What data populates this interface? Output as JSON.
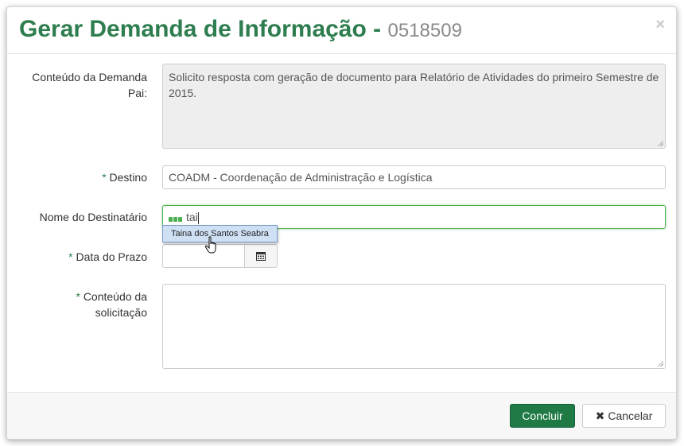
{
  "modal": {
    "title": "Gerar Demanda de Informação -",
    "demand_number": "0518509",
    "close_symbol": "×"
  },
  "form": {
    "parent_content": {
      "label": "Conteúdo da Demanda Pai:",
      "value": "Solicito resposta com geração de documento para Relatório de Atividades do primeiro Semestre de 2015."
    },
    "destino": {
      "required_mark": "*",
      "label": "Destino",
      "value": "COADM - Coordenação de Administração e Logística"
    },
    "destinatario": {
      "label": "Nome do Destinatário",
      "value": "tai",
      "suggestions": [
        "Taina dos Santos Seabra"
      ]
    },
    "data_prazo": {
      "required_mark": "*",
      "label": "Data do Prazo",
      "value": "",
      "icon": "calendar-icon"
    },
    "conteudo_solicitacao": {
      "required_mark": "*",
      "label_line1": "Conteúdo da",
      "label_line2": "solicitação",
      "value": ""
    }
  },
  "footer": {
    "confirm_label": "Concluir",
    "cancel_label": "Cancelar",
    "cancel_icon": "close-icon"
  },
  "colors": {
    "title_green": "#2e7d4f",
    "primary_button": "#1f7a45",
    "suggestion_highlight": "#cfe0f4"
  }
}
